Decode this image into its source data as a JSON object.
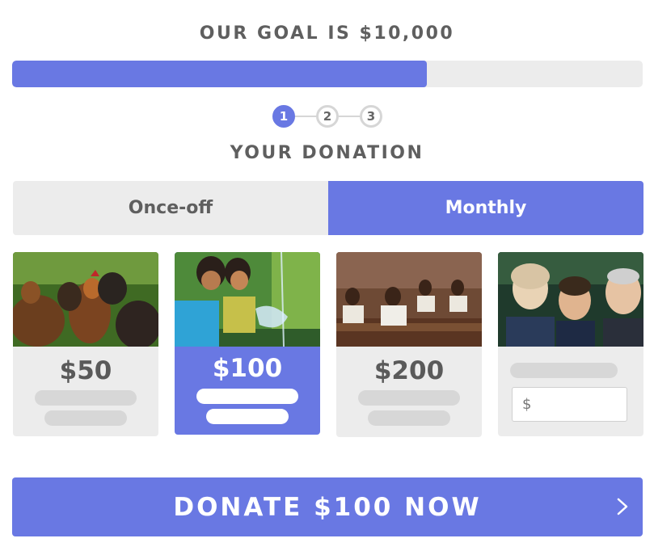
{
  "goal": {
    "title": "OUR GOAL IS $10,000",
    "progress_fraction": 0.658
  },
  "stepper": {
    "steps": [
      "1",
      "2",
      "3"
    ],
    "active_step": 1
  },
  "donation": {
    "title": "YOUR DONATION",
    "frequency_options": [
      "Once-off",
      "Monthly"
    ],
    "selected_frequency": "Monthly"
  },
  "tiers": [
    {
      "amount": "$50",
      "image": "chickens-photo",
      "selected": false
    },
    {
      "amount": "$100",
      "image": "children-water-photo",
      "selected": true
    },
    {
      "amount": "$200",
      "image": "classroom-photo",
      "selected": false
    }
  ],
  "custom_amount": {
    "currency_symbol": "$",
    "value": "",
    "image": "family-photo"
  },
  "cta": {
    "label": "DONATE $100 NOW",
    "icon": "chevron-right-icon"
  },
  "colors": {
    "accent": "#6978e3",
    "neutral_bg": "#ececec",
    "placeholder": "#d7d7d7",
    "text": "#5f5f5f"
  }
}
